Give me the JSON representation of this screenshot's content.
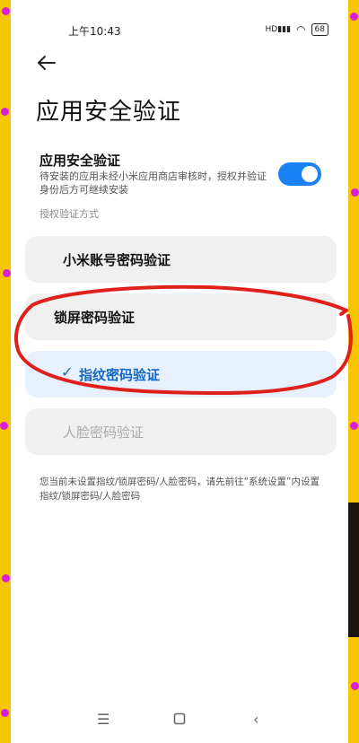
{
  "status_bar": {
    "time": "上午10:43",
    "signal_tag": "HD",
    "battery": "68"
  },
  "header": {
    "back_icon": "arrow-left-icon",
    "title": "应用安全验证"
  },
  "security_toggle": {
    "title": "应用安全验证",
    "description": "待安装的应用未经小米应用商店审核时，授权并验证身份后方可继续安装",
    "enabled": true,
    "accent_color": "#1a82f4"
  },
  "auth_section": {
    "label": "授权验证方式",
    "options": [
      {
        "label": "小米账号密码验证",
        "state": "normal"
      },
      {
        "label": "锁屏密码验证",
        "state": "normal"
      },
      {
        "label": "指纹密码验证",
        "state": "selected",
        "check_icon": "check-icon"
      },
      {
        "label": "人脸密码验证",
        "state": "disabled"
      }
    ]
  },
  "note": "您当前未设置指纹/锁屏密码/人脸密码，请先前往“系统设置”内设置指纹/锁屏密码/人脸密码",
  "nav_bar": {
    "menu_icon": "menu-icon",
    "home_icon": "home-icon",
    "back_icon": "back-icon"
  },
  "annotation": {
    "shape": "red-hand-drawn-ellipse",
    "color": "#e0201b"
  }
}
